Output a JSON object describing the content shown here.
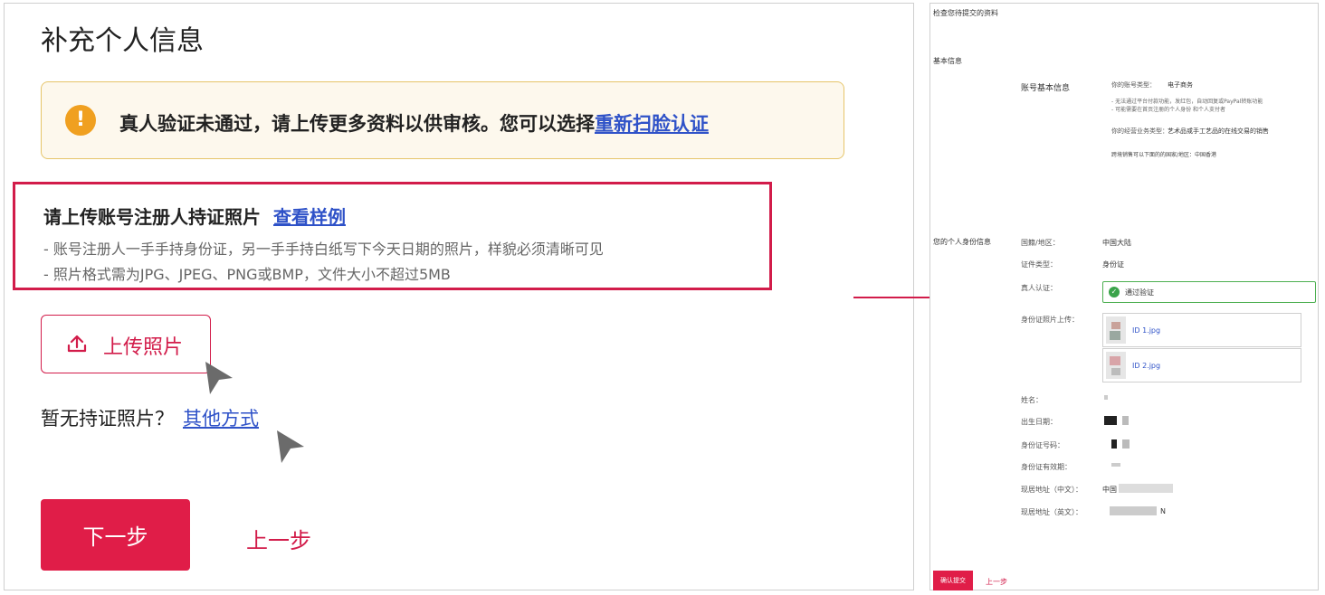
{
  "left": {
    "title": "补充个人信息",
    "alert": {
      "text": "真人验证未通过，请上传更多资料以供审核。您可以选择",
      "link": "重新扫脸认证"
    },
    "requirement": {
      "title": "请上传账号注册人持证照片",
      "link": "查看样例",
      "lines": [
        "- 账号注册人一手手持身份证，另一手手持白纸写下今天日期的照片，样貌必须清晰可见",
        "- 照片格式需为JPG、JPEG、PNG或BMP，文件大小不超过5MB"
      ]
    },
    "upload_label": "上传照片",
    "no_id": {
      "text": "暂无持证照片？",
      "link": "其他方式"
    },
    "next_label": "下一步",
    "prev_label": "上一步"
  },
  "right": {
    "header": "检查您待提交的资料",
    "basic_section": "基本信息",
    "account_info_label": "账号基本信息",
    "account_type_label": "你的账号类型：",
    "account_type_value": "电子商务",
    "account_notes": [
      "- 无法通过平台付款功能，发红包，自动回复或PayPal转账功能",
      "- 可能需要在首页注册的个人身份 和个人支付者"
    ],
    "business_type_label": "你的经营业务类型：",
    "business_type_value": "艺术品或手工艺品的在线交易的销售",
    "sales_line": "跨境销售可以下面的的国家/地区：中国香港",
    "identity_section": "您的个人身份信息",
    "fields": {
      "region_label": "国籍/地区：",
      "region_value": "中国大陆",
      "doc_type_label": "证件类型：",
      "doc_type_value": "身份证",
      "verify_label": "真人认证：",
      "verify_value": "通过验证",
      "upload_label": "身份证照片上传：",
      "file1": "ID 1.jpg",
      "file2": "ID 2.jpg",
      "name_label": "姓名：",
      "birth_label": "出生日期：",
      "id_no_label": "身份证号码：",
      "expiry_label": "身份证有效期：",
      "addr_cn_label": "现居地址（中文）：",
      "addr_cn_value": "中国",
      "addr_en_label": "现居地址（英文）：",
      "addr_en_value": "N"
    },
    "confirm_label": "确认提交",
    "prev_label": "上一步"
  },
  "colors": {
    "accent_red": "#e01d48",
    "link_blue": "#2f52c8",
    "alert_bg": "#fdf8ed",
    "alert_border": "#e6c56a",
    "warning_orange": "#f0a020",
    "success_green": "#3aa34a"
  }
}
